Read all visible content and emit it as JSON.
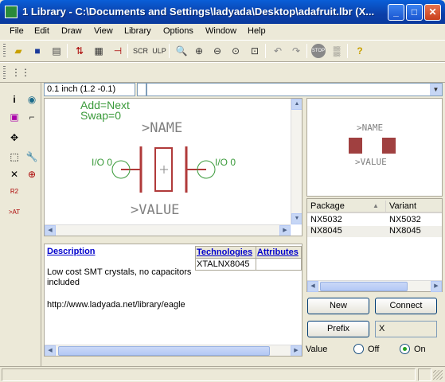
{
  "window": {
    "title": "1 Library - C:\\Documents and Settings\\ladyada\\Desktop\\adafruit.lbr (X..."
  },
  "menu": [
    "File",
    "Edit",
    "Draw",
    "View",
    "Library",
    "Options",
    "Window",
    "Help"
  ],
  "coordinate": "0.1 inch (1.2 -0.1)",
  "canvas": {
    "add_label": "Add=Next",
    "swap_label": "Swap=0",
    "name_text": ">NAME",
    "value_text": ">VALUE",
    "pin_left": "I/O 0",
    "pin_right": "I/O 0"
  },
  "description": {
    "link": "Description",
    "text": "Low cost SMT crystals, no capacitors included",
    "url": "http://www.ladyada.net/library/eagle"
  },
  "technologies": {
    "headers": [
      "Technologies",
      "Attributes"
    ],
    "rows": [
      [
        "XTALNX8045",
        ""
      ]
    ]
  },
  "preview": {
    "name_text": ">NAME",
    "value_text": ">VALUE"
  },
  "packages": {
    "headers": [
      "Package",
      "Variant"
    ],
    "rows": [
      {
        "package": "NX5032",
        "variant": "NX5032"
      },
      {
        "package": "NX8045",
        "variant": "NX8045"
      }
    ]
  },
  "buttons": {
    "new": "New",
    "connect": "Connect",
    "prefix": "Prefix"
  },
  "prefix_value": "X",
  "value_options": {
    "label": "Value",
    "off": "Off",
    "on": "On",
    "selected": "On"
  },
  "colors": {
    "layer_green": "#3a9a3a",
    "layer_red": "#b03a3a",
    "name_gray": "#808080",
    "pad_red": "#a04040"
  }
}
